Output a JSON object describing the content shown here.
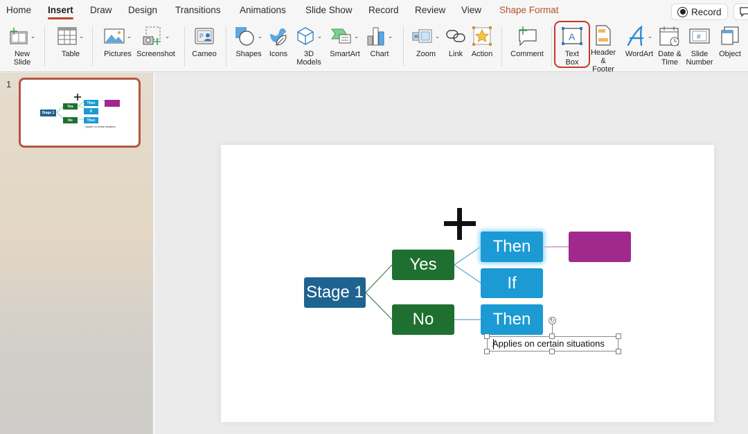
{
  "menu": {
    "tabs": [
      {
        "label": "Home"
      },
      {
        "label": "Insert",
        "active": true
      },
      {
        "label": "Draw"
      },
      {
        "label": "Design"
      },
      {
        "label": "Transitions"
      },
      {
        "label": "Animations"
      },
      {
        "label": "Slide Show"
      },
      {
        "label": "Record"
      },
      {
        "label": "Review"
      },
      {
        "label": "View"
      },
      {
        "label": "Shape Format",
        "contextual": true
      }
    ],
    "record_button": "Record"
  },
  "ribbon": {
    "new_slide": "New\nSlide",
    "table": "Table",
    "pictures": "Pictures",
    "screenshot": "Screenshot",
    "cameo": "Cameo",
    "shapes": "Shapes",
    "icons": "Icons",
    "models_3d": "3D\nModels",
    "smartart": "SmartArt",
    "chart": "Chart",
    "zoom": "Zoom",
    "link": "Link",
    "action": "Action",
    "comment": "Comment",
    "text_box": "Text\nBox",
    "header_footer": "Header &\nFooter",
    "wordart": "WordArt",
    "date_time": "Date &\nTime",
    "slide_number": "Slide\nNumber",
    "object": "Object",
    "slide_number_glyph": "#",
    "text_box_glyph": "A"
  },
  "thumbnails": {
    "slide_number": "1"
  },
  "slide": {
    "stage": "Stage 1",
    "yes": "Yes",
    "no": "No",
    "then_top": "Then",
    "if": "If",
    "then_bottom": "Then",
    "purple_box": "",
    "textbox_text": "Applies on certain situations",
    "thumb_note": "*Applies on certain situations"
  },
  "colors": {
    "stage": "#1f6390",
    "green": "#1f7030",
    "blue": "#1b9ad4",
    "purple": "#a1298d",
    "accent": "#c0392b"
  }
}
